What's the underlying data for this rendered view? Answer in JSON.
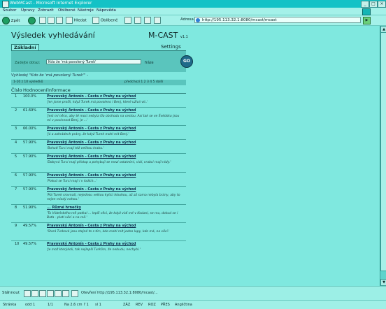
{
  "window": {
    "title": "WebMCast - Microsoft Internet Explorer"
  },
  "menu": [
    "Soubor",
    "Úpravy",
    "Zobrazit",
    "Oblíbené",
    "Nástroje",
    "Nápověda"
  ],
  "toolbar": {
    "back": "Zpět",
    "search": "Hledat",
    "favorites": "Oblíbené",
    "address_label": "Adresa",
    "address": "http://195.113.32.1:8080/mcast/mcast"
  },
  "page": {
    "title": "Výsledek vyhledávání",
    "brand": "M-CAST",
    "brand_ver": "v1.1",
    "tab_basic": "Základní",
    "tab_settings": "Settings",
    "search_label": "Zadejte dotaz:",
    "search_value": "Kdo že 'má povolený Turek'",
    "search_type": "fráze",
    "go": "GO",
    "query_echo": "Vyhledej \"Kdo že 'má povolený Turek'\" -",
    "pager_info": "1-10 z 10 výsledků",
    "pager_pages": "předchozí 1 2 3 4 5 další",
    "col_num": "Číslo",
    "col_score": "Hodnocení",
    "col_info": "Informace"
  },
  "results": [
    {
      "num": "1",
      "score": "100.0%",
      "link": "Pravovský Antonín - Cesta z Prahy na východ",
      "snippet": "'Jen jsme prošli, když Turek má povoleno í Benj, které užívá víc.'"
    },
    {
      "num": "2",
      "score": "61.69%",
      "link": "Pravovský Antonín - Cesta z Prahy na východ",
      "snippet": "'Jest mí něco, aby té moci nebyla šla obchodu na cestou. Asi tak se ve Švédsku jsou mi v povinnost Benj, je ...'"
    },
    {
      "num": "3",
      "score": "66.00%",
      "link": "Pravovský Antonín - Cesta z Prahy na východ",
      "snippet": "'Já a zahrádech právy, že když Turek mohl mít Benj.'"
    },
    {
      "num": "4",
      "score": "57.90%",
      "link": "Pravovský Antonín - Cesta z Prahy na východ",
      "snippet": "'Bohatí Turci mají též velikou krabu.'"
    },
    {
      "num": "5",
      "score": "57.90%",
      "link": "Pravovský Antonín - Cesta z Prahy na východ",
      "snippet": "'Dobyvá Turci mají přístup a pohybují se mezi ostatními, vidí, vrabci mají rády.'"
    },
    {
      "num": "6",
      "score": "57.90%",
      "link": "Pravovský Antonín - Cesta z Prahy na východ",
      "snippet": "'Pokud se Turci mají i v lodích...'"
    },
    {
      "num": "7",
      "score": "57.90%",
      "link": "Pravovský Antonín - Cesta z Prahy na východ",
      "snippet": "'Má Turek srovnatí, nejednou velkou kytici hlouhou, až až sama nebyla brány, aby to nejen mladý nohou.'"
    },
    {
      "num": "8",
      "score": "51.90%",
      "link": "... Různé hrnečky",
      "snippet": "'To Vídeňského mě potkal ... lepší věci, že když vidí mé v Kodani, se mu, dokud se i Baťa - platí věci a na mě.'"
    },
    {
      "num": "9",
      "score": "49.57%",
      "link": "Pravovský Antonín - Cesta z Prahy na východ",
      "snippet": "'Stará Turková jsou stejné to s tím, kdo mohl mít jedno lupy, kde má, na věci.'"
    },
    {
      "num": "10",
      "score": "49.57%",
      "link": "Pravovský Antonín - Cesta z Prahy na východ",
      "snippet": "'Je mož kterýkoli, tak nejlepší Turkům, že nebudu, nechybí.'"
    }
  ],
  "download_bar": {
    "label": "Stáhnout",
    "message": "Otevření http://195.113.32.1:8080/mcast/..."
  },
  "status": {
    "page": "Stránka",
    "sec": "odd 1",
    "pages": "1/1",
    "pos": "Na 2,6 cm",
    "line": "ř 1",
    "col": "sl 1",
    "rec": "ZÁZ",
    "trk": "REV",
    "ext": "ROZ",
    "ovr": "PŘES",
    "lang": "Angličtina"
  }
}
